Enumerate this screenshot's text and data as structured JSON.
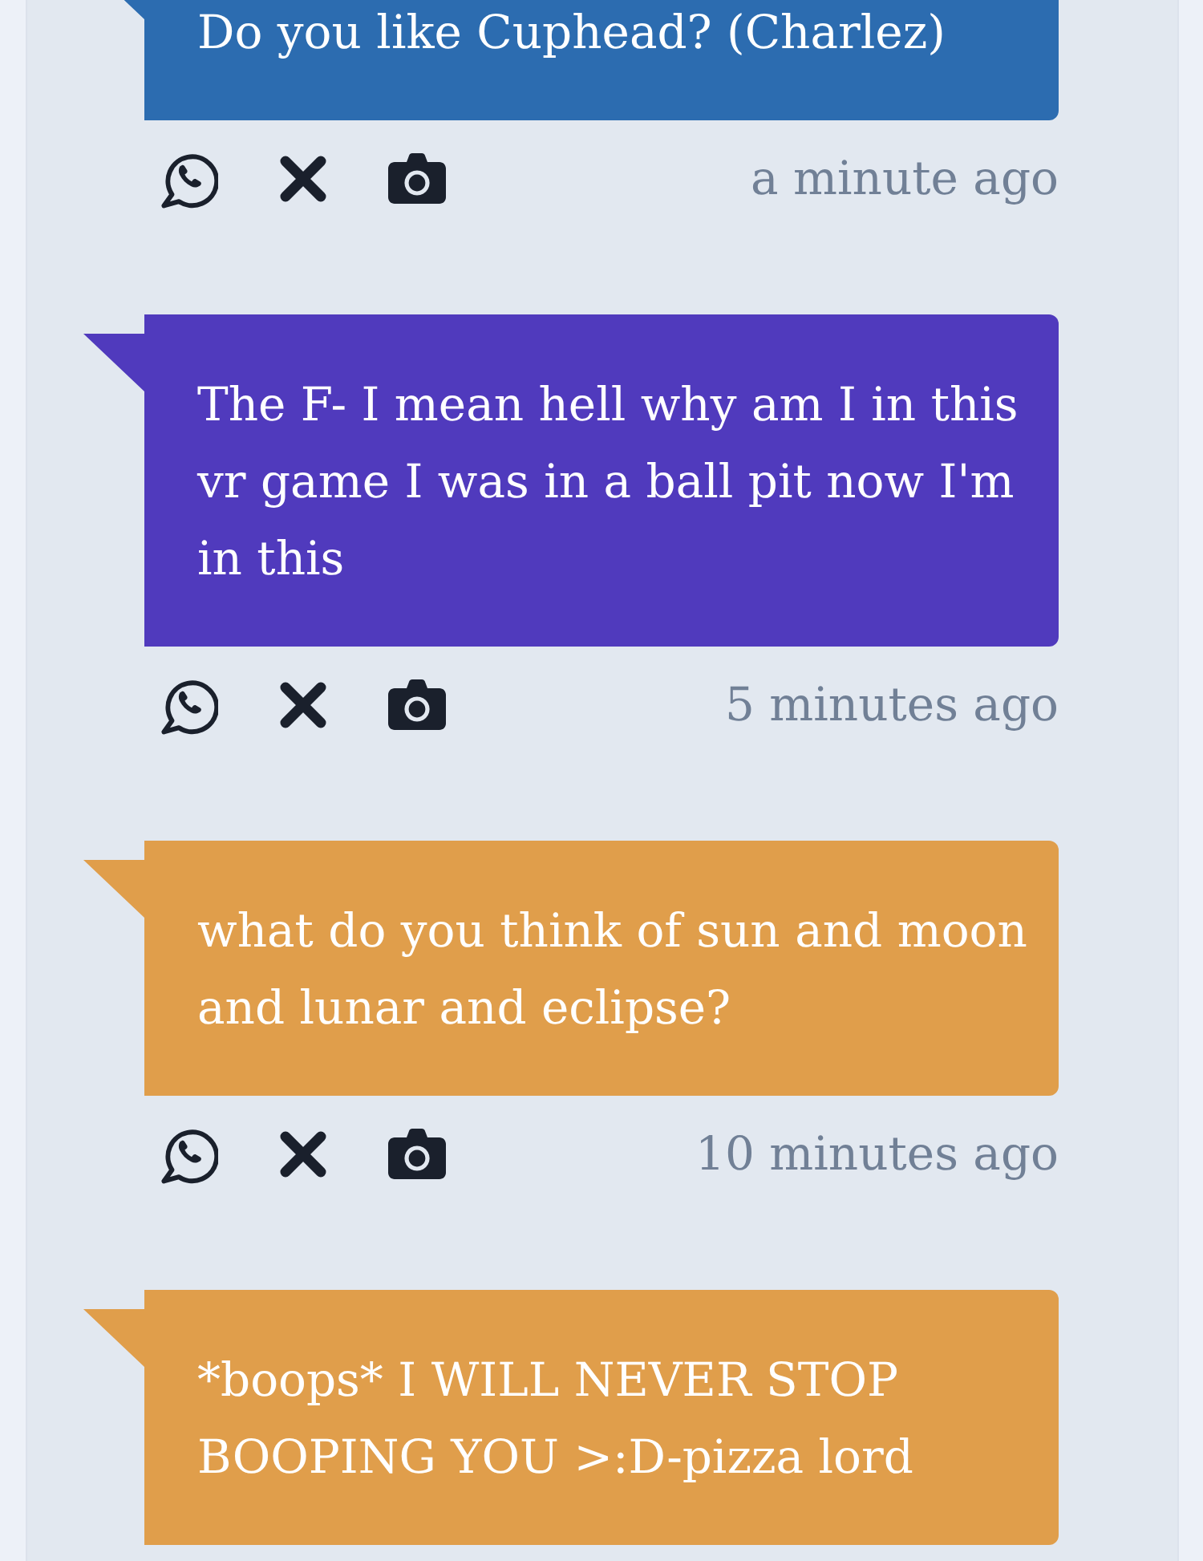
{
  "messages": [
    {
      "text": "Do you like Cuphead? (Charlez)",
      "color": "#2c6cb0",
      "time": "a minute ago"
    },
    {
      "text": "The F- I mean hell why am I in this vr game I was in a ball pit now I'm in this",
      "color": "#503abd",
      "time": "5 minutes ago"
    },
    {
      "text": "what do you think of sun and moon and lunar and eclipse?",
      "color": "#e09e4b",
      "time": "10 minutes ago"
    },
    {
      "text": "*boops* I WILL NEVER STOP BOOPING YOU >:D-pizza lord",
      "color": "#e09e4b"
    }
  ]
}
